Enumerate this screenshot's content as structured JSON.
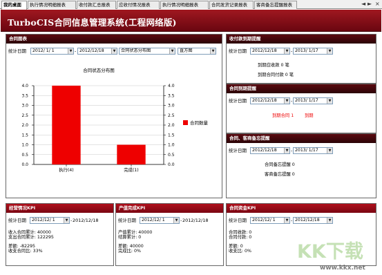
{
  "tabs": [
    "我的桌面",
    "执行情况明细报表",
    "收付款汇总报表",
    "应收付情况报表",
    "执行情况明细报表",
    "合同发货记录报表",
    "客商备忘提醒报表"
  ],
  "tab_controls": [
    "◄",
    "►",
    "×"
  ],
  "app_title": "TurboCIS合同信息管理系统(工程网络版)",
  "contract_chart": {
    "header": "合同图表",
    "date_label": "统计日期",
    "date_from": "2012/ 1/ 1",
    "date_to": "2012/12/18",
    "dash": "-",
    "category_select": "合同状态分布图",
    "chart_type_select": "直方图"
  },
  "chart_data": {
    "type": "bar",
    "title": "合同状态分布图",
    "categories": [
      "执行(4)",
      "完成(1)"
    ],
    "series": [
      {
        "name": "合同数量",
        "values": [
          4,
          1
        ]
      }
    ],
    "ylim": [
      0,
      4
    ],
    "yticks": [
      "0.0",
      "0.5",
      "1.0",
      "1.5",
      "2.0",
      "2.5",
      "3.0",
      "3.5",
      "4.0"
    ],
    "color": "#ee0000",
    "grid": true,
    "legend": "right"
  },
  "payment_reminder": {
    "header": "收付款到期提醒",
    "date_label": "统计日期",
    "date_from": "2012/12/18",
    "date_to": "2013/ 1/17",
    "dash": "-",
    "line1": "到期应收款 0 笔",
    "line2": "到期合同付款 0 笔"
  },
  "contract_due": {
    "header": "合同到期提醒",
    "date_label": "统计日期",
    "date_from": "2012/12/18",
    "date_to": "2013/ 1/17",
    "dash": "-",
    "due_text": "到期合同 1",
    "due_link": "到期"
  },
  "memo_reminder": {
    "header": "合同、客商备忘提醒",
    "date_label": "统计日期",
    "date_from": "2012/12/18",
    "date_to": "2013/ 1/17",
    "dash": "-",
    "line1": "合同备忘提醒 0",
    "line2": "客商备忘提醒 0"
  },
  "business_kpi": {
    "header": "经营情况KPI",
    "date_label": "统计日期",
    "date_from": "2012/12/ 1",
    "date_to": "2012/12/18",
    "dash": "-",
    "l1": "收入合同累计: 40000",
    "l2": "支出合同累计: 122295",
    "l3": "差额: -82295",
    "l4": "收支合同比: 33%"
  },
  "output_kpi": {
    "header": "产值完成KPI",
    "date_label": "统计日期",
    "date_from": "2012/12/ 1",
    "date_to": "2012/12/18",
    "dash": "-",
    "l1": "产值累计: 40000",
    "l2": "结算累计: 0",
    "l3": "差额: 40000",
    "l4": "完成比: 0%"
  },
  "fund_kpi": {
    "header": "合同资金KPI",
    "date_label": "统计日期",
    "date_from": "2012/12/ 1",
    "date_to": "2012/12/18",
    "dash": "-",
    "l1": "合同收款: 0",
    "l2": "合同付款: 0",
    "l3": "差额: 0",
    "l4": "收支比: 0%"
  },
  "watermark": {
    "logo": "KK下载",
    "url": "www.kkx.net"
  },
  "colors": {
    "title_bar": "#8a0e18",
    "panel_header": "#3a060a",
    "bar": "#ee0000"
  }
}
